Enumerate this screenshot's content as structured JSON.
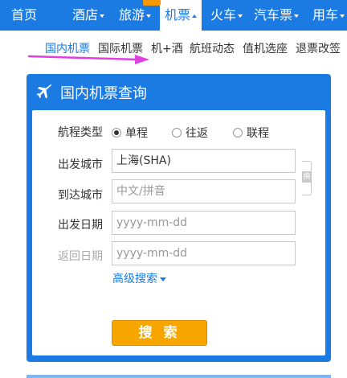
{
  "nav": {
    "items": [
      {
        "label": "首页",
        "dropdown": false
      },
      {
        "label": "酒店",
        "dropdown": true
      },
      {
        "label": "旅游",
        "dropdown": true
      },
      {
        "label": "机票",
        "dropdown": true,
        "active": true
      },
      {
        "label": "火车",
        "dropdown": true
      },
      {
        "label": "汽车票",
        "dropdown": true
      },
      {
        "label": "用车",
        "dropdown": true
      }
    ]
  },
  "subnav": {
    "items": [
      "国内机票",
      "国际机票",
      "机+酒",
      "航班动态",
      "值机选座",
      "退票改签"
    ]
  },
  "panel": {
    "title": "国内机票查询",
    "icon": "airplane-icon"
  },
  "form": {
    "trip_type_label": "航程类型",
    "trip_options": [
      {
        "label": "单程",
        "checked": true
      },
      {
        "label": "往返",
        "checked": false
      },
      {
        "label": "联程",
        "checked": false
      }
    ],
    "depart_city_label": "出发城市",
    "depart_city_value": "上海(SHA)",
    "arrive_city_label": "到达城市",
    "arrive_city_placeholder": "中文/拼音",
    "depart_date_label": "出发日期",
    "depart_date_placeholder": "yyyy-mm-dd",
    "return_date_label": "返回日期",
    "return_date_placeholder": "yyyy-mm-dd",
    "swap_label": "换",
    "advanced_search": "高级搜索",
    "search_button": "搜 索"
  },
  "colors": {
    "brand_blue": "#1b7be2",
    "search_orange": "#f7a600",
    "arrow_magenta": "#e040e0"
  }
}
